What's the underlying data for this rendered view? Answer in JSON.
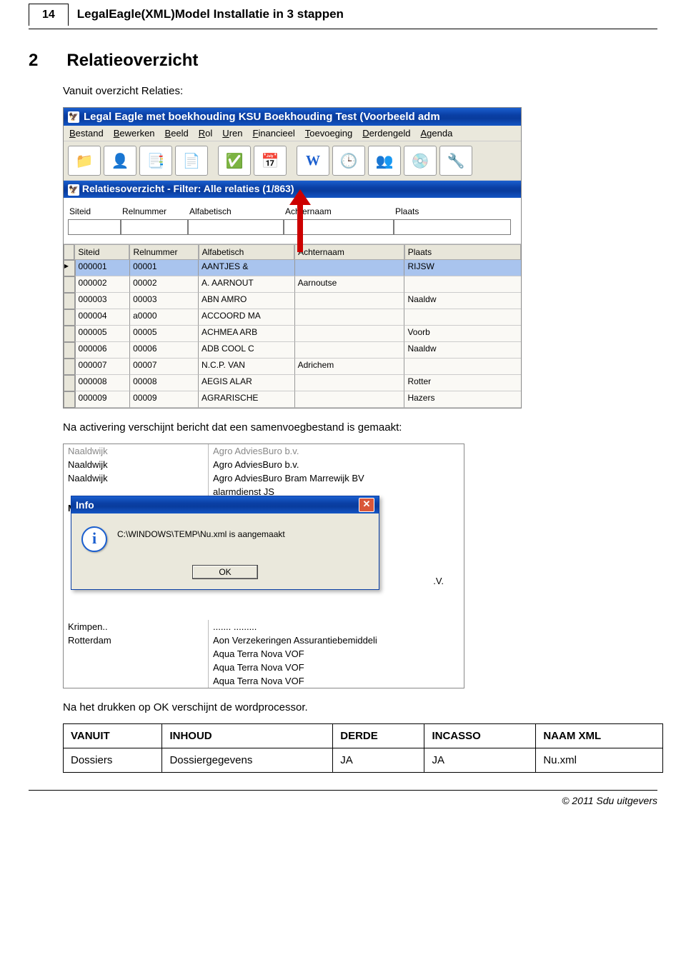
{
  "page_number": "14",
  "doc_header": "LegalEagle(XML)Model Installatie in 3 stappen",
  "section_num": "2",
  "section_title": "Relatieoverzicht",
  "intro": "Vanuit overzicht Relaties:",
  "app": {
    "title": "Legal Eagle met boekhouding KSU Boekhouding Test (Voorbeeld adm",
    "menus": [
      "Bestand",
      "Bewerken",
      "Beeld",
      "Rol",
      "Uren",
      "Financieel",
      "Toevoeging",
      "Derdengeld",
      "Agenda"
    ],
    "subwin_title": "Relatiesoverzicht - Filter: Alle relaties (1/863)",
    "search_fields": [
      "Siteid",
      "Relnummer",
      "Alfabetisch",
      "Achternaam",
      "Plaats"
    ],
    "grid_headers": [
      "Siteid",
      "Relnummer",
      "Alfabetisch",
      "Achternaam",
      "Plaats"
    ],
    "rows": [
      {
        "siteid": "000001",
        "relnr": "00001",
        "alf": "AANTJES &",
        "ach": "",
        "plaats": "RIJSW",
        "sel": true
      },
      {
        "siteid": "000002",
        "relnr": "00002",
        "alf": "A. AARNOUT",
        "ach": "Aarnoutse",
        "plaats": ""
      },
      {
        "siteid": "000003",
        "relnr": "00003",
        "alf": "ABN AMRO",
        "ach": "",
        "plaats": "Naaldw"
      },
      {
        "siteid": "000004",
        "relnr": "a0000",
        "alf": "ACCOORD MA",
        "ach": "",
        "plaats": ""
      },
      {
        "siteid": "000005",
        "relnr": "00005",
        "alf": "ACHMEA ARB",
        "ach": "",
        "plaats": "Voorb"
      },
      {
        "siteid": "000006",
        "relnr": "00006",
        "alf": "ADB COOL C",
        "ach": "",
        "plaats": "Naaldw"
      },
      {
        "siteid": "000007",
        "relnr": "00007",
        "alf": "N.C.P. VAN",
        "ach": "Adrichem",
        "plaats": ""
      },
      {
        "siteid": "000008",
        "relnr": "00008",
        "alf": "AEGIS ALAR",
        "ach": "",
        "plaats": "Rotter"
      },
      {
        "siteid": "000009",
        "relnr": "00009",
        "alf": "AGRARISCHE",
        "ach": "",
        "plaats": "Hazers"
      }
    ],
    "toolbar_icons": [
      "folder-icon",
      "person-icon",
      "list-icon",
      "page-icon",
      "check-icon",
      "calendar-icon",
      "word-icon",
      "clock-icon",
      "group-icon",
      "cd-icon",
      "tools-icon"
    ]
  },
  "mid_text": "Na activering verschijnt bericht dat een samenvoegbestand is gemaakt:",
  "snippet2": {
    "rows_top": [
      {
        "c1": "Naaldwijk",
        "c2": "Agro AdviesBuro b.v."
      },
      {
        "c1": "Naaldwijk",
        "c2": "Agro AdviesBuro b.v."
      },
      {
        "c1": "Naaldwijk",
        "c2": "Agro AdviesBuro Bram Marrewijk BV"
      },
      {
        "c1": "",
        "c2": "alarmdienst JS"
      }
    ],
    "rows_bottom": [
      {
        "c1": "Krimpen..",
        "c2": "....... .........",
        "tail": ".V."
      },
      {
        "c1": "Rotterdam",
        "c2": "Aon Verzekeringen Assurantiebemiddeli"
      },
      {
        "c1": "",
        "c2": "Aqua Terra Nova VOF"
      },
      {
        "c1": "",
        "c2": "Aqua Terra Nova VOF"
      },
      {
        "c1": "",
        "c2": "Aqua Terra Nova VOF"
      }
    ],
    "dialog": {
      "title": "Info",
      "msg": "C:\\WINDOWS\\TEMP\\Nu.xml is aangemaakt",
      "ok": "OK"
    },
    "side_letter": "M"
  },
  "after_dialog": "Na het drukken op OK verschijnt de wordprocessor.",
  "def_table": {
    "headers": [
      "VANUIT",
      "INHOUD",
      "DERDE",
      "INCASSO",
      "NAAM XML"
    ],
    "row": [
      "Dossiers",
      "Dossiergegevens",
      "JA",
      "JA",
      "Nu.xml"
    ]
  },
  "footer": "© 2011 Sdu uitgevers"
}
